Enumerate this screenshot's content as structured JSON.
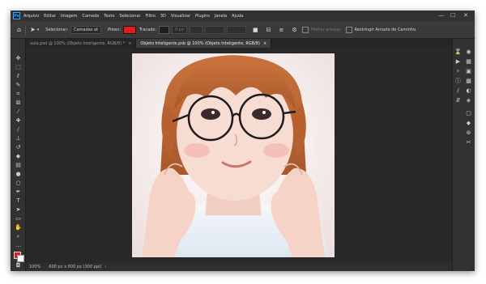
{
  "app": {
    "logo_text": "Ps"
  },
  "menu": [
    "Arquivo",
    "Editar",
    "Imagem",
    "Camada",
    "Texto",
    "Selecionar",
    "Filtro",
    "3D",
    "Visualizar",
    "Plugins",
    "Janela",
    "Ajuda"
  ],
  "window_controls": {
    "minimize": "—",
    "maximize": "☐",
    "close": "✕"
  },
  "options": {
    "select_label": "Selecionar:",
    "select_value": "Camadas at",
    "fill_label": "Preen:",
    "stroke_label": "Tracado:",
    "stroke_value": "0 px",
    "align_edges": "Melhor arestas",
    "restrict_label": "Restringir Arrasto de Caminho",
    "colors": {
      "fill": "#e11d1d"
    }
  },
  "tabs": [
    {
      "label": "aula.psd @ 100% (Objeto Inteligente, RGB/8) *",
      "close": "×"
    },
    {
      "label": "Objeto Inteligente.psb @ 100% (Objeto Inteligente, RGB/8)",
      "close": "×"
    }
  ],
  "status": {
    "zoom": "100%",
    "doc_size": "600 px x 600 px (300 ppi)"
  },
  "tools": [
    "move-icon",
    "marquee-icon",
    "lasso-icon",
    "quick-select-icon",
    "crop-icon",
    "frame-icon",
    "eyedropper-icon",
    "healing-icon",
    "brush-icon",
    "stamp-icon",
    "history-brush-icon",
    "eraser-icon",
    "gradient-icon",
    "blur-icon",
    "dodge-icon",
    "pen-icon",
    "type-icon",
    "path-select-icon",
    "shape-icon",
    "hand-icon",
    "zoom-icon",
    "more-icon",
    "colors-icon",
    "quick-mask-icon"
  ],
  "dock": [
    "history-icon",
    "properties-icon",
    "layers-icon",
    "channels-icon",
    "paths-icon",
    "brush-icon",
    "adjust-icon",
    "styles-icon",
    "swatches-icon",
    "libraries-icon"
  ]
}
